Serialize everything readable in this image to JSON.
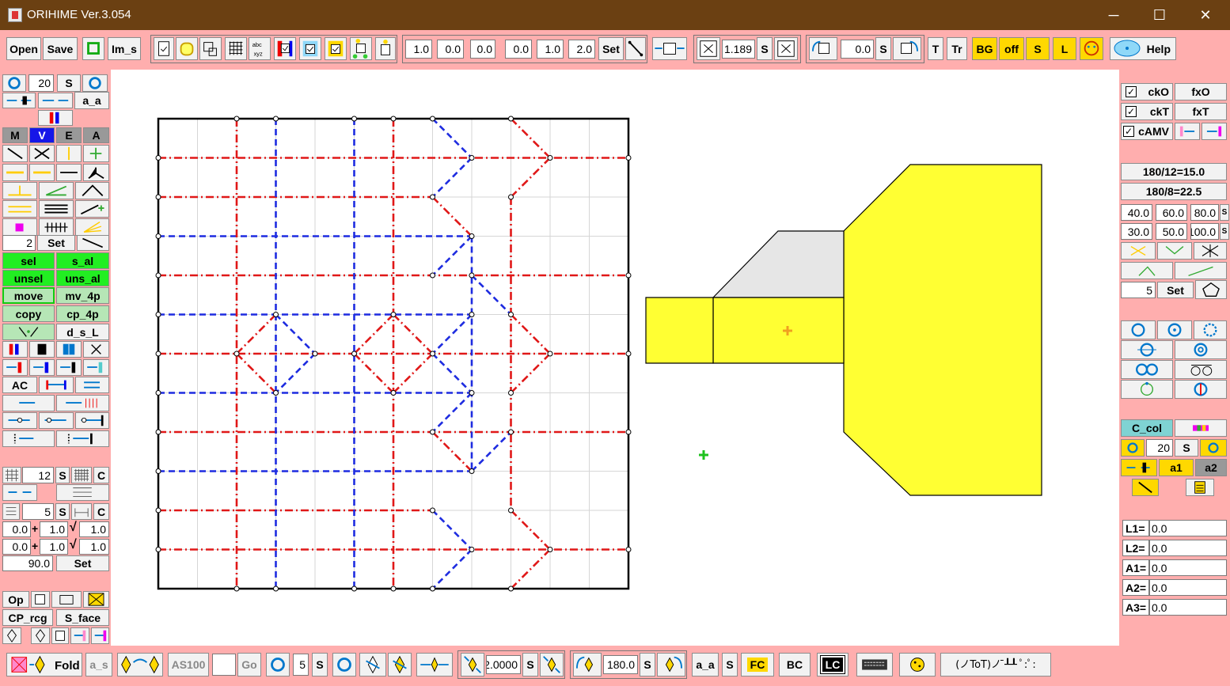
{
  "window": {
    "title": "ORIHIME Ver.3.054",
    "minimize": "─",
    "maximize": "☐",
    "close": "✕"
  },
  "toolbar": {
    "open": "Open",
    "save": "Save",
    "im_s": "Im_s",
    "line_inputs_a": [
      "1.0",
      "0.0",
      "0.0"
    ],
    "line_inputs_b": [
      "0.0",
      "1.0",
      "2.0"
    ],
    "set": "Set",
    "scale_value": "1.189",
    "s": "S",
    "rotate_value": "0.0",
    "t": "T",
    "tr": "Tr",
    "bg": "BG",
    "off": "off",
    "s2": "S",
    "l": "L",
    "help": "Help"
  },
  "left": {
    "rotate_value": "20",
    "s": "S",
    "a_a": "a_a",
    "mode_tabs": [
      "M",
      "V",
      "E",
      "A"
    ],
    "divide_value": "2",
    "set": "Set",
    "sel": "sel",
    "s_al": "s_al",
    "unsel": "unsel",
    "uns_al": "uns_al",
    "move": "move",
    "mv_4p": "mv_4p",
    "copy": "copy",
    "cp_4p": "cp_4p",
    "d_s_l": "d_s_L",
    "ac": "AC",
    "grid_value": "12",
    "grid_s": "S",
    "grid_c": "C",
    "sub_value": "5",
    "sub_s": "S",
    "sub_c": "C",
    "row1": [
      "0.0",
      "1.0",
      "1.0"
    ],
    "row2": [
      "0.0",
      "1.0",
      "1.0"
    ],
    "angle_value": "90.0",
    "angle_set": "Set",
    "op": "Op",
    "cp_rcg": "CP_rcg",
    "s_face": "S_face"
  },
  "right": {
    "cko": "ckO",
    "fxo": "fxO",
    "ckt": "ckT",
    "fxt": "fxT",
    "camv": "cAMV",
    "angle1": "180/12=15.0",
    "angle2": "180/8=22.5",
    "deg_row1": [
      "40.0",
      "60.0",
      "80.0"
    ],
    "deg_row2": [
      "30.0",
      "50.0",
      "100.0"
    ],
    "s": "S",
    "poly_value": "5",
    "poly_set": "Set",
    "c_col": "C_col",
    "rot_value": "20",
    "rot_s": "S",
    "a1": "a1",
    "a2": "a2",
    "measures": [
      {
        "label": "L1=",
        "value": "0.0"
      },
      {
        "label": "L2=",
        "value": "0.0"
      },
      {
        "label": "A1=",
        "value": "0.0"
      },
      {
        "label": "A2=",
        "value": "0.0"
      },
      {
        "label": "A3=",
        "value": "0.0"
      }
    ]
  },
  "bottom": {
    "fold": "Fold",
    "a_s": "a_s",
    "as100": "AS100",
    "go": "Go",
    "step_value": "5",
    "step_s": "S",
    "scale_value": "2.0000",
    "scale_s": "S",
    "angle_value": "180.0",
    "angle_s": "S",
    "a_a": "a_a",
    "s": "S",
    "fc": "FC",
    "bc": "BC",
    "lc": "LC",
    "emoticon": "(ノToT)ノ ̄┸┸ ﾟ:ﾟ:"
  },
  "colors": {
    "mountain": "#e01818",
    "valley": "#1e2ce0",
    "face_yellow": "#ffff33",
    "face_gray": "#e6e6e6",
    "title_bar": "#6b4012",
    "panel_bg": "#ffaeae"
  }
}
